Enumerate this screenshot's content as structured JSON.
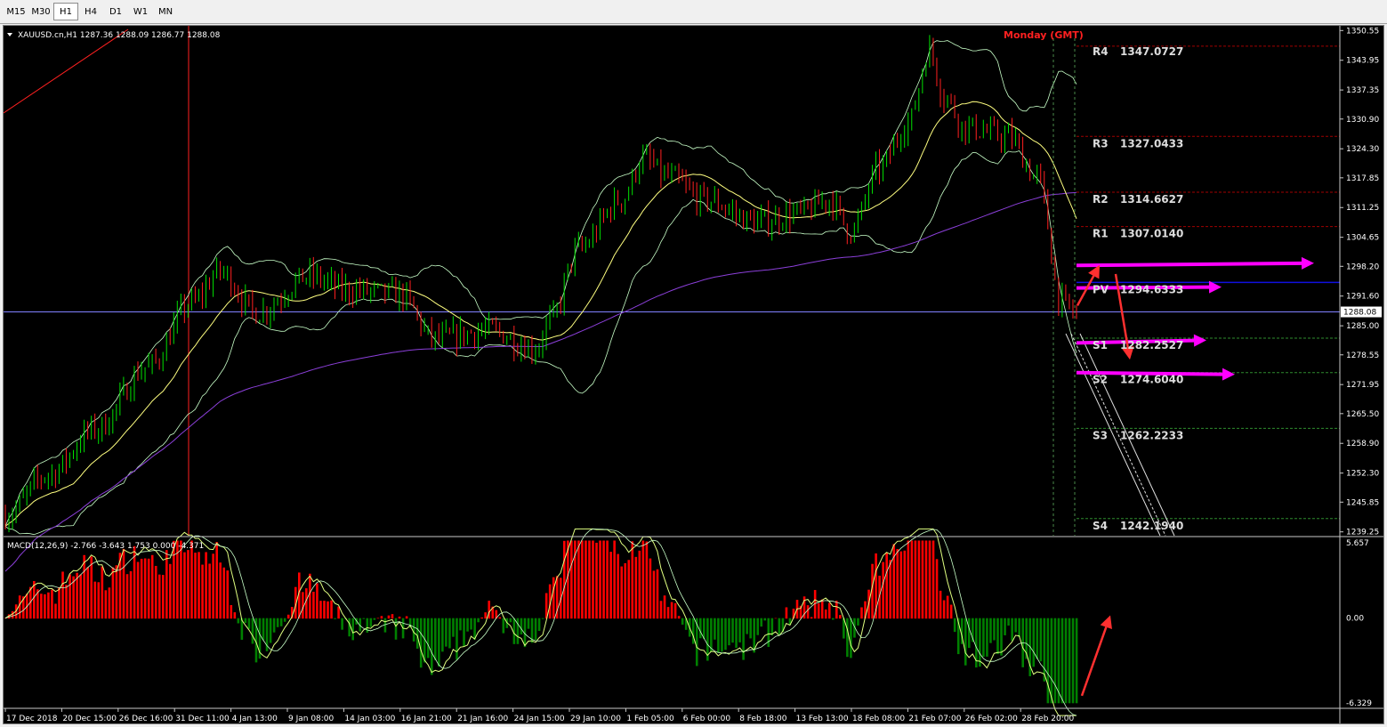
{
  "toolbar": {
    "timeframes": [
      "M15",
      "M30",
      "H1",
      "H4",
      "D1",
      "W1",
      "MN"
    ],
    "active": "H1"
  },
  "main_chart": {
    "symbol_line": "XAUUSD.cn,H1  1287.36 1288.09 1286.77 1288.08",
    "day_label": "Monday (GMT)",
    "current_price": "1288.08",
    "price_axis": [
      "1350.55",
      "1343.95",
      "1337.35",
      "1330.90",
      "1324.30",
      "1317.85",
      "1311.25",
      "1304.65",
      "1298.20",
      "1291.60",
      "1285.00",
      "1278.55",
      "1271.95",
      "1265.50",
      "1258.90",
      "1252.30",
      "1245.85",
      "1239.25"
    ],
    "pivot_levels": [
      {
        "name": "R4",
        "value": "1347.0727"
      },
      {
        "name": "R3",
        "value": "1327.0433"
      },
      {
        "name": "R2",
        "value": "1314.6627"
      },
      {
        "name": "R1",
        "value": "1307.0140"
      },
      {
        "name": "PV",
        "value": "1294.6333"
      },
      {
        "name": "S1",
        "value": "1282.2527"
      },
      {
        "name": "S2",
        "value": "1274.6040"
      },
      {
        "name": "S3",
        "value": "1262.2233"
      },
      {
        "name": "S4",
        "value": "1242.1940"
      }
    ]
  },
  "macd": {
    "label": "MACD(12,26,9) -2.766 -3.643 1.753 0.000 -4.371",
    "axis": [
      "5.657",
      "0.00",
      "-6.329"
    ]
  },
  "time_axis": [
    "17 Dec 2018",
    "20 Dec 15:00",
    "26 Dec 16:00",
    "31 Dec 11:00",
    "4 Jan 13:00",
    "9 Jan 08:00",
    "14 Jan 03:00",
    "16 Jan 21:00",
    "21 Jan 16:00",
    "24 Jan 15:00",
    "29 Jan 10:00",
    "1 Feb 05:00",
    "6 Feb 00:00",
    "8 Feb 18:00",
    "13 Feb 13:00",
    "18 Feb 08:00",
    "21 Feb 07:00",
    "26 Feb 02:00",
    "28 Feb 20:00"
  ],
  "colors": {
    "bull": "#00e000",
    "bear": "#ff2020",
    "ma_fast": "#ffff80",
    "ma_slow": "#8b3fd9",
    "bands": "#c8ffc8",
    "pivot_line": "#a00000",
    "pv_line": "#1010e0",
    "annotation_arrow": "#ff00ff",
    "red_arrow": "#ff3030",
    "macd_pos": "#ff0000",
    "macd_neg": "#008000"
  }
}
